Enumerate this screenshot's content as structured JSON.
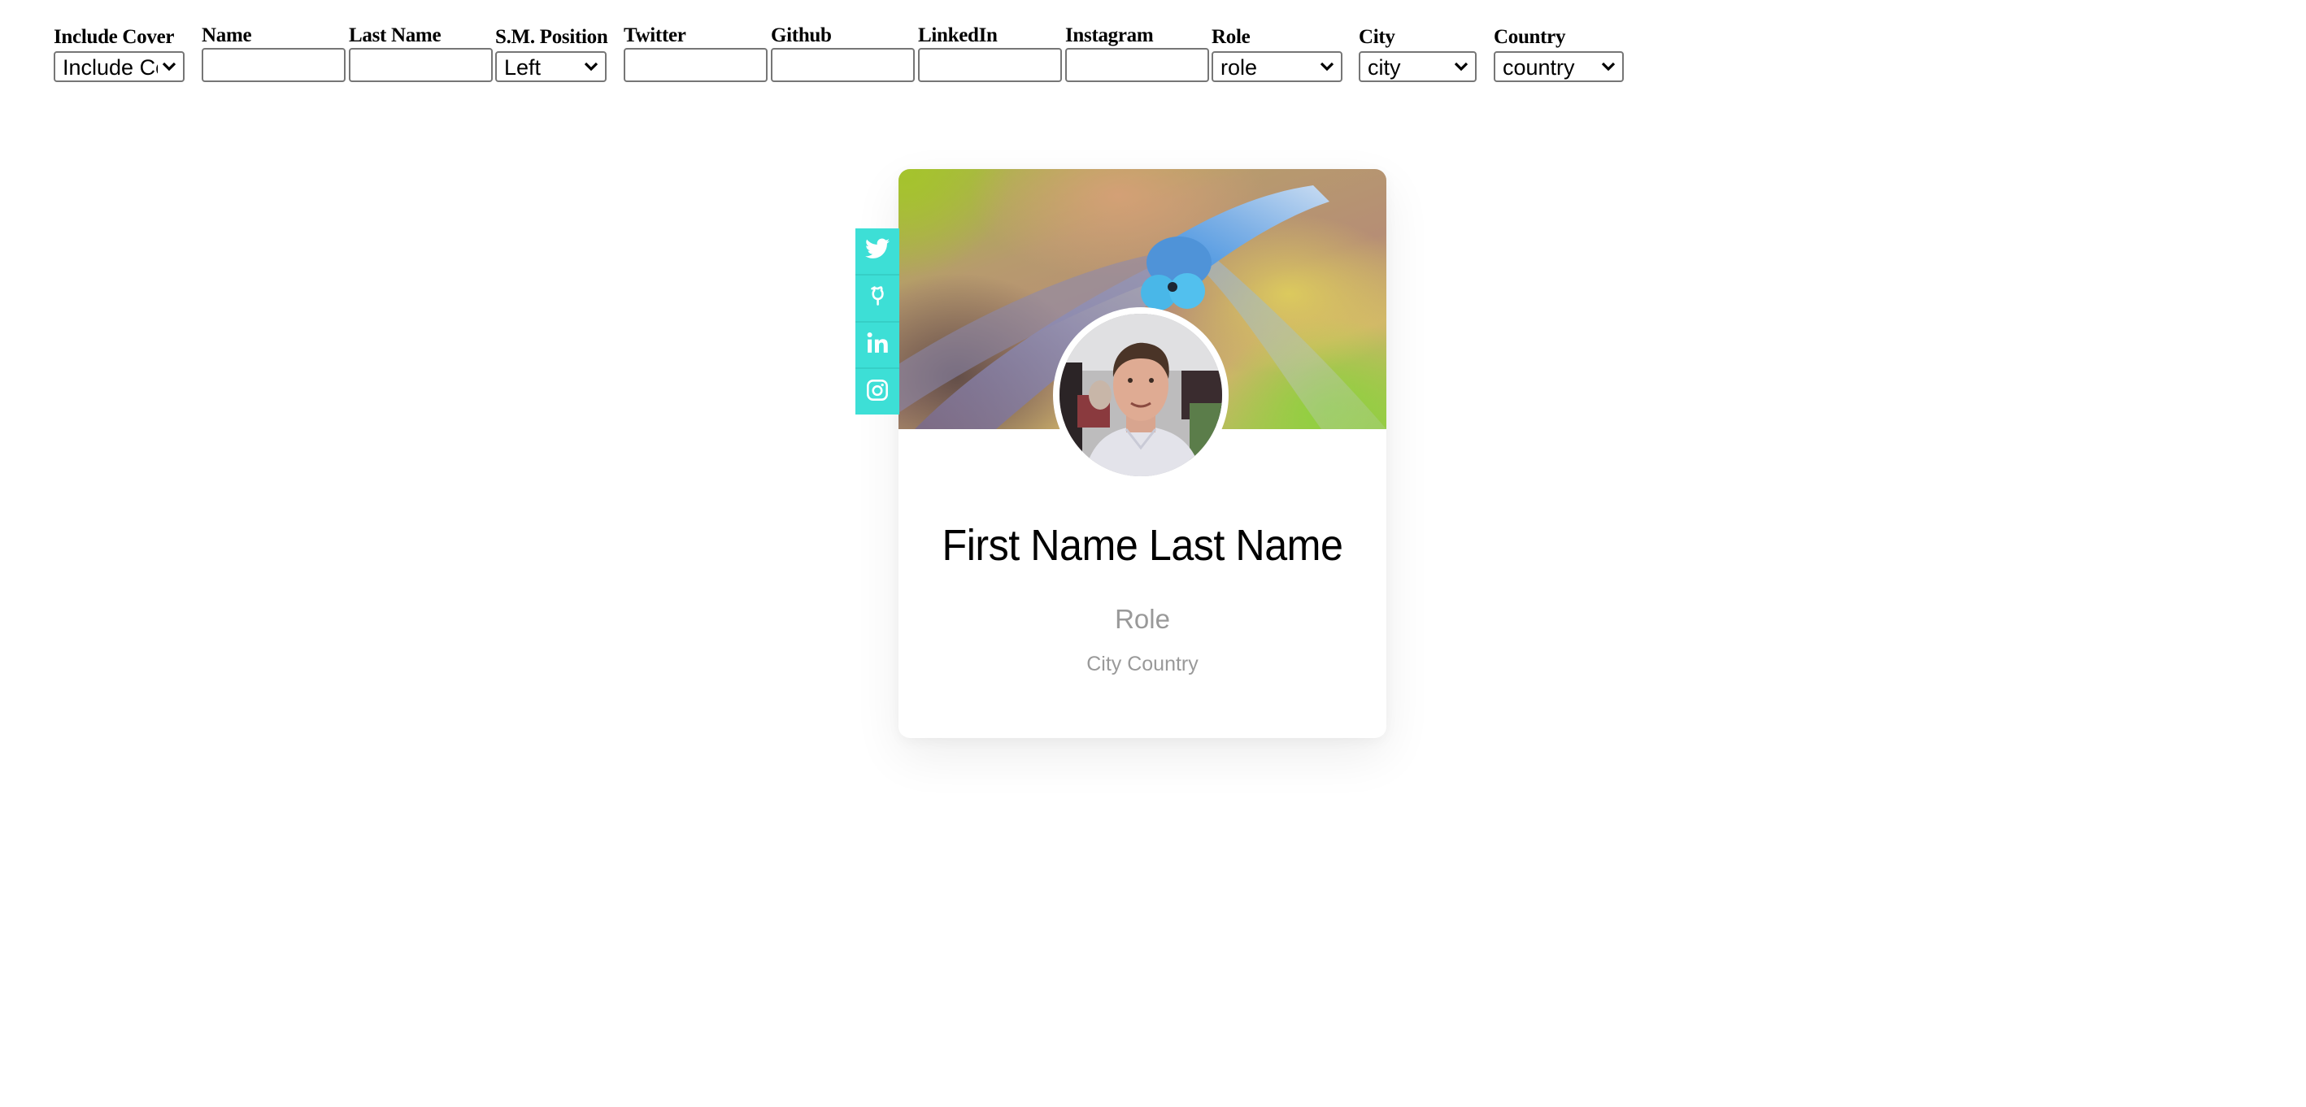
{
  "form": {
    "include_cover": {
      "label": "Include Cover",
      "selected": "Include Cover",
      "display": "Include Cʀ"
    },
    "name": {
      "label": "Name",
      "value": "",
      "placeholder": ""
    },
    "last_name": {
      "label": "Last Name",
      "value": "",
      "placeholder": ""
    },
    "sm_position": {
      "label": "S.M. Position",
      "selected": "Left"
    },
    "twitter": {
      "label": "Twitter",
      "value": "",
      "placeholder": ""
    },
    "github": {
      "label": "Github",
      "value": "",
      "placeholder": ""
    },
    "linkedin": {
      "label": "LinkedIn",
      "value": "",
      "placeholder": ""
    },
    "instagram": {
      "label": "Instagram",
      "value": "",
      "placeholder": ""
    },
    "role": {
      "label": "Role",
      "selected": "role"
    },
    "city": {
      "label": "City",
      "selected": "city"
    },
    "country": {
      "label": "Country",
      "selected": "country"
    }
  },
  "card": {
    "full_name": "First Name Last Name",
    "role": "Role",
    "location": "City Country",
    "cover_image": "dragonfly-cover",
    "avatar_image": "profile-photo",
    "social_position": "left",
    "social_links": [
      {
        "name": "twitter",
        "icon": "twitter-icon"
      },
      {
        "name": "github",
        "icon": "github-icon"
      },
      {
        "name": "linkedin",
        "icon": "linkedin-icon"
      },
      {
        "name": "instagram",
        "icon": "instagram-icon"
      }
    ],
    "colors": {
      "social_bar": "#3ddfd6",
      "name_text": "#000000",
      "secondary_text": "#999999"
    }
  }
}
